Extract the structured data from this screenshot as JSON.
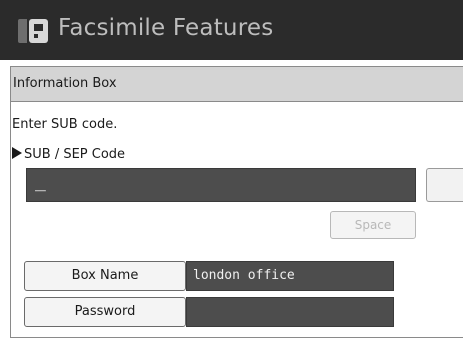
{
  "header": {
    "title": "Facsimile Features",
    "icon": "fax-icon"
  },
  "panel": {
    "title": "Information Box"
  },
  "instruction": "Enter SUB code.",
  "sub_sep_field": {
    "label": "SUB / SEP Code",
    "value": "_"
  },
  "space_button": {
    "label": "Space"
  },
  "box_name": {
    "label": "Box Name",
    "value": "london office"
  },
  "password": {
    "label": "Password",
    "value": ""
  },
  "colors": {
    "header_bg": "#2b2b2b",
    "header_text": "#bdbdbd",
    "field_bg": "#4d4d4d",
    "title_bar_bg": "#d4d4d4"
  }
}
